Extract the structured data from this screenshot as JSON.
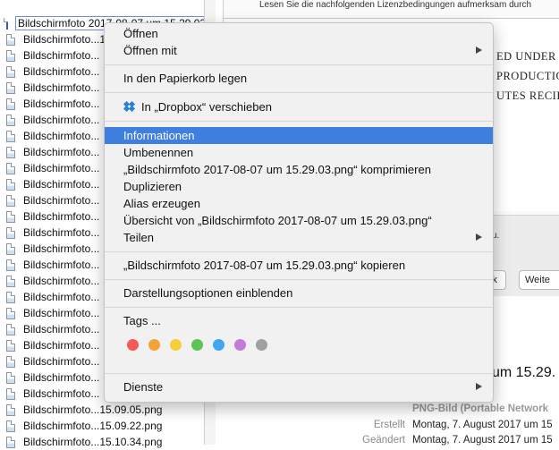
{
  "files": [
    {
      "label": "Bildschirmfoto 2017-08-07 um 15.29.03.png",
      "selected": true
    },
    {
      "label": "Bildschirmfoto...15.28.58.png"
    },
    {
      "label": "Bildschirmfoto..."
    },
    {
      "label": "Bildschirmfoto..."
    },
    {
      "label": "Bildschirmfoto..."
    },
    {
      "label": "Bildschirmfoto..."
    },
    {
      "label": "Bildschirmfoto..."
    },
    {
      "label": "Bildschirmfoto..."
    },
    {
      "label": "Bildschirmfoto..."
    },
    {
      "label": "Bildschirmfoto..."
    },
    {
      "label": "Bildschirmfoto..."
    },
    {
      "label": "Bildschirmfoto..."
    },
    {
      "label": "Bildschirmfoto..."
    },
    {
      "label": "Bildschirmfoto..."
    },
    {
      "label": "Bildschirmfoto..."
    },
    {
      "label": "Bildschirmfoto..."
    },
    {
      "label": "Bildschirmfoto..."
    },
    {
      "label": "Bildschirmfoto..."
    },
    {
      "label": "Bildschirmfoto..."
    },
    {
      "label": "Bildschirmfoto..."
    },
    {
      "label": "Bildschirmfoto..."
    },
    {
      "label": "Bildschirmfoto..."
    },
    {
      "label": "Bildschirmfoto..."
    },
    {
      "label": "Bildschirmfoto..."
    },
    {
      "label": "Bildschirmfoto...15.09.05.png"
    },
    {
      "label": "Bildschirmfoto...15.09.22.png"
    },
    {
      "label": "Bildschirmfoto...15.10.34.png"
    }
  ],
  "preview": {
    "doc_header": "Lesen Sie die nachfolgenden Lizenzbedingungen aufmerksam durch",
    "doc_lines": [
      "ED UNDER TH",
      "PRODUCTION",
      "UTES RECIPIE"
    ],
    "footer_text": "zu.",
    "btn_left": "ck",
    "btn_right": "Weite",
    "info_title": "um 15.29.",
    "info_kind": "PNG-Bild (Portable Network",
    "created_key": "Erstellt",
    "created_val": "Montag, 7. August 2017 um 15",
    "modified_key": "Geändert",
    "modified_val": "Montag, 7. August 2017 um 15"
  },
  "menu": {
    "open": "Öffnen",
    "open_with": "Öffnen mit",
    "trash": "In den Papierkorb legen",
    "dropbox": "In „Dropbox“ verschieben",
    "info": "Informationen",
    "rename": "Umbenennen",
    "compress": "„Bildschirmfoto 2017-08-07 um 15.29.03.png“ komprimieren",
    "duplicate": "Duplizieren",
    "alias": "Alias erzeugen",
    "quicklook": "Übersicht von „Bildschirmfoto 2017-08-07 um 15.29.03.png“",
    "share": "Teilen",
    "copy": "„Bildschirmfoto 2017-08-07 um 15.29.03.png“ kopieren",
    "view_options": "Darstellungsoptionen einblenden",
    "tags": "Tags ...",
    "services": "Dienste"
  },
  "tag_colors": [
    {
      "name": "red-tag",
      "color": "#f35b57"
    },
    {
      "name": "orange-tag",
      "color": "#f6a23a"
    },
    {
      "name": "yellow-tag",
      "color": "#f5ce3a"
    },
    {
      "name": "green-tag",
      "color": "#5cc553"
    },
    {
      "name": "blue-tag",
      "color": "#3fa6f2"
    },
    {
      "name": "purple-tag",
      "color": "#c47ad8"
    },
    {
      "name": "gray-tag",
      "color": "#a0a0a0"
    }
  ],
  "accent": "#3f7fe0"
}
